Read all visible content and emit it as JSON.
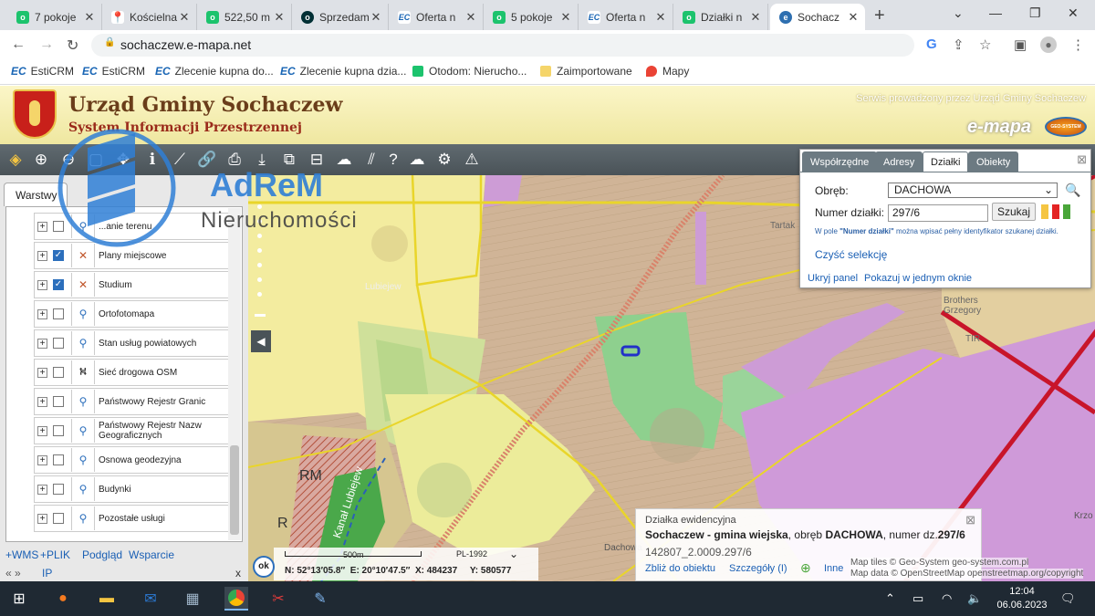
{
  "browser": {
    "tabs": [
      {
        "title": "7 pokoje",
        "icon": "otodom-icon",
        "color": "#1cc36d"
      },
      {
        "title": "Kościelna",
        "icon": "maps-pin-icon",
        "color": "#ea4335"
      },
      {
        "title": "522,50 m",
        "icon": "otodom-icon",
        "color": "#1cc36d"
      },
      {
        "title": "Sprzedam",
        "icon": "olx-icon",
        "color": "#002f34"
      },
      {
        "title": "Oferta n",
        "icon": "esticrm-icon",
        "color": "#1a66b5"
      },
      {
        "title": "5 pokoje",
        "icon": "otodom-icon",
        "color": "#1cc36d"
      },
      {
        "title": "Oferta n",
        "icon": "esticrm-icon",
        "color": "#1a66b5"
      },
      {
        "title": "Działki n",
        "icon": "otodom-icon",
        "color": "#1cc36d"
      },
      {
        "title": "Sochacz",
        "icon": "emapa-icon",
        "color": "#2e6fb0"
      }
    ],
    "url": "sochaczew.e-mapa.net",
    "bookmarks": [
      {
        "label": "EstiCRM",
        "prefix": "EC"
      },
      {
        "label": "EstiCRM",
        "prefix": "EC"
      },
      {
        "label": "Zlecenie kupna do...",
        "prefix": "EC"
      },
      {
        "label": "Zlecenie kupna dzia...",
        "prefix": "EC"
      },
      {
        "label": "Otodom: Nierucho...",
        "prefix": ""
      },
      {
        "label": "Zaimportowane",
        "prefix": ""
      },
      {
        "label": "Mapy",
        "prefix": ""
      }
    ]
  },
  "header": {
    "title": "Urząd Gminy Sochaczew",
    "subtitle": "System Informacji Przestrzennej",
    "service_text": "Serwis prowadzony przez Urząd Gminy Sochaczew",
    "logo_text": "e-mapa",
    "brand_badge": "GEO-SYSTEM"
  },
  "sidebar": {
    "tab_label": "Warstwy",
    "layers": [
      {
        "label": "...anie terenu",
        "checked": false,
        "icon": "map-pin-icon"
      },
      {
        "label": "Plany miejscowe",
        "checked": true,
        "icon": "plan-icon"
      },
      {
        "label": "Studium",
        "checked": true,
        "icon": "plan-icon"
      },
      {
        "label": "Ortofotomapa",
        "checked": false,
        "icon": "map-pin-icon"
      },
      {
        "label": "Stan usług powiatowych",
        "checked": false,
        "icon": "map-pin-icon"
      },
      {
        "label": "Sieć drogowa OSM",
        "checked": false,
        "icon": "road-icon"
      },
      {
        "label": "Państwowy Rejestr Granic",
        "checked": false,
        "icon": "map-pin-icon"
      },
      {
        "label": "Państwowy Rejestr Nazw Geograficznych",
        "checked": false,
        "icon": "map-pin-icon"
      },
      {
        "label": "Osnowa geodezyjna",
        "checked": false,
        "icon": "map-pin-icon"
      },
      {
        "label": "Budynki",
        "checked": false,
        "icon": "map-pin-icon"
      },
      {
        "label": "Pozostałe usługi",
        "checked": false,
        "icon": "map-pin-icon"
      }
    ],
    "links": [
      "+WMS",
      "+PLIK",
      "Podgląd",
      "Wsparcie"
    ],
    "bottom_left": "« »",
    "bottom_ip": "IP",
    "bottom_close": "x"
  },
  "watermark": {
    "brand": "AdReM",
    "sub": "Nieruchomości"
  },
  "search_panel": {
    "tabs": [
      "Współrzędne",
      "Adresy",
      "Działki",
      "Obiekty"
    ],
    "active_tab": "Działki",
    "obreb_label": "Obręb:",
    "obreb_value": "DACHOWA",
    "numer_label": "Numer działki:",
    "numer_value": "297/6",
    "search_button": "Szukaj",
    "hint_prefix": "W pole ",
    "hint_bold": "\"Numer działki\"",
    "hint_suffix": " można wpisać pełny identyfikator szukanej działki.",
    "clear_link": "Czyść selekcję",
    "hide_link": "Ukryj panel",
    "show_link": "Pokazuj w jednym oknie"
  },
  "map": {
    "labels": [
      "Lubiejew",
      "Tartak",
      "Brothers Grzegory",
      "TIR",
      "RM",
      "R",
      "Kanał Lubiejew",
      "Dachowa",
      "Krzo"
    ]
  },
  "info_popup": {
    "heading": "Działka ewidencyjna",
    "place": "Sochaczew - gmina wiejska",
    "obreb_text": ", obręb ",
    "obreb": "DACHOWA",
    "numer_text": ", numer dz.",
    "numer": "297/6",
    "identifier": "142807_2.0009.297/6",
    "zoom_link": "Zbliż do obiektu",
    "details_link": "Szczegóły (I)",
    "more_link": "Inne"
  },
  "scale": {
    "label": "500m",
    "crs": "PL-1992",
    "ok": "ok",
    "coords": "N: 52°13′05.8″  E: 20°10′47.5″  X: 484237     Y: 580577"
  },
  "attribution": {
    "line1": "Map tiles © Geo-System geo-system.com.pl",
    "line2": "Map data © OpenStreetMap openstreetmap.org/copyright"
  },
  "taskbar": {
    "time": "12:04",
    "date": "06.06.2023"
  }
}
